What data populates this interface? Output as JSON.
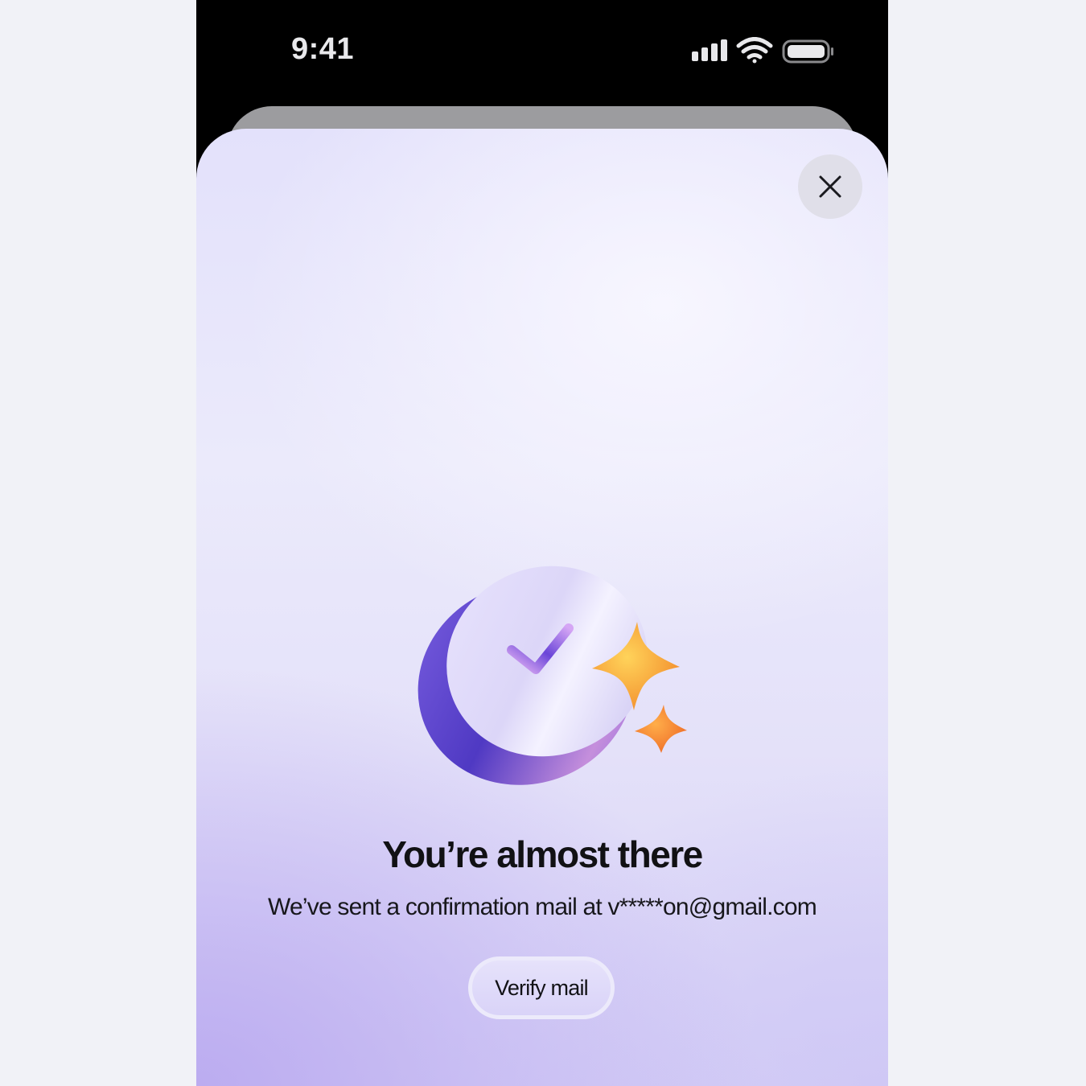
{
  "status_bar": {
    "time": "9:41",
    "icons": [
      "cellular-signal-icon",
      "wifi-icon",
      "battery-icon"
    ]
  },
  "modal": {
    "close_icon": "close-icon",
    "illustration": "check-badge-with-sparkles",
    "title": "You’re almost there",
    "subtitle": "We’ve sent a confirmation mail at v*****on@gmail.com",
    "button_label": "Verify mail"
  },
  "colors": {
    "accent": "#5b45c9",
    "sparkle": "#f7a83a",
    "sheet_background": "#e6e3fa"
  }
}
